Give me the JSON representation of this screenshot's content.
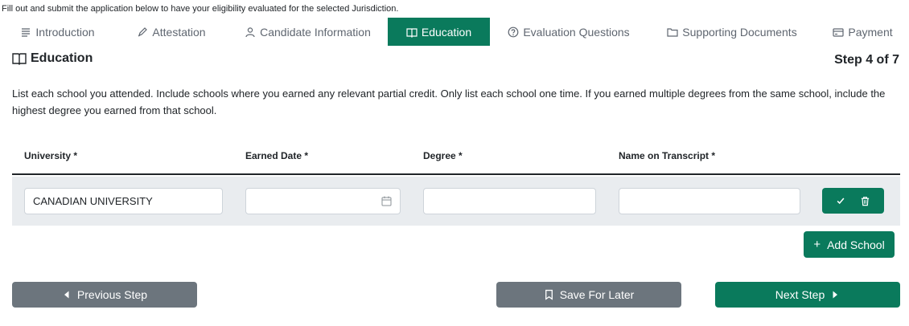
{
  "intro_note": "Fill out and submit the application below to have your eligibility evaluated for the selected Jurisdiction.",
  "tabs": [
    {
      "label": "Introduction",
      "icon": "list-icon"
    },
    {
      "label": "Attestation",
      "icon": "pen-icon"
    },
    {
      "label": "Candidate Information",
      "icon": "user-icon"
    },
    {
      "label": "Education",
      "icon": "book-icon",
      "active": true
    },
    {
      "label": "Evaluation Questions",
      "icon": "question-circle-icon"
    },
    {
      "label": "Supporting Documents",
      "icon": "folder-icon"
    },
    {
      "label": "Payment",
      "icon": "credit-card-icon"
    }
  ],
  "section": {
    "title": "Education",
    "step": "Step 4 of 7",
    "instructions": "List each school you attended. Include schools where you earned any relevant partial credit. Only list each school one time. If you earned multiple degrees from the same school, include the highest degree you earned from that school."
  },
  "table": {
    "headers": [
      "University *",
      "Earned Date *",
      "Degree *",
      "Name on Transcript *"
    ],
    "rows": [
      {
        "university": "CANADIAN UNIVERSITY",
        "earned_date": "",
        "degree": "",
        "name_on_transcript": ""
      }
    ]
  },
  "buttons": {
    "add_school": "Add School",
    "previous": "Previous Step",
    "save": "Save For Later",
    "next": "Next Step"
  },
  "colors": {
    "accent": "#0a7a5c",
    "secondary": "#6c757d",
    "row_bg": "#e9ecef"
  }
}
